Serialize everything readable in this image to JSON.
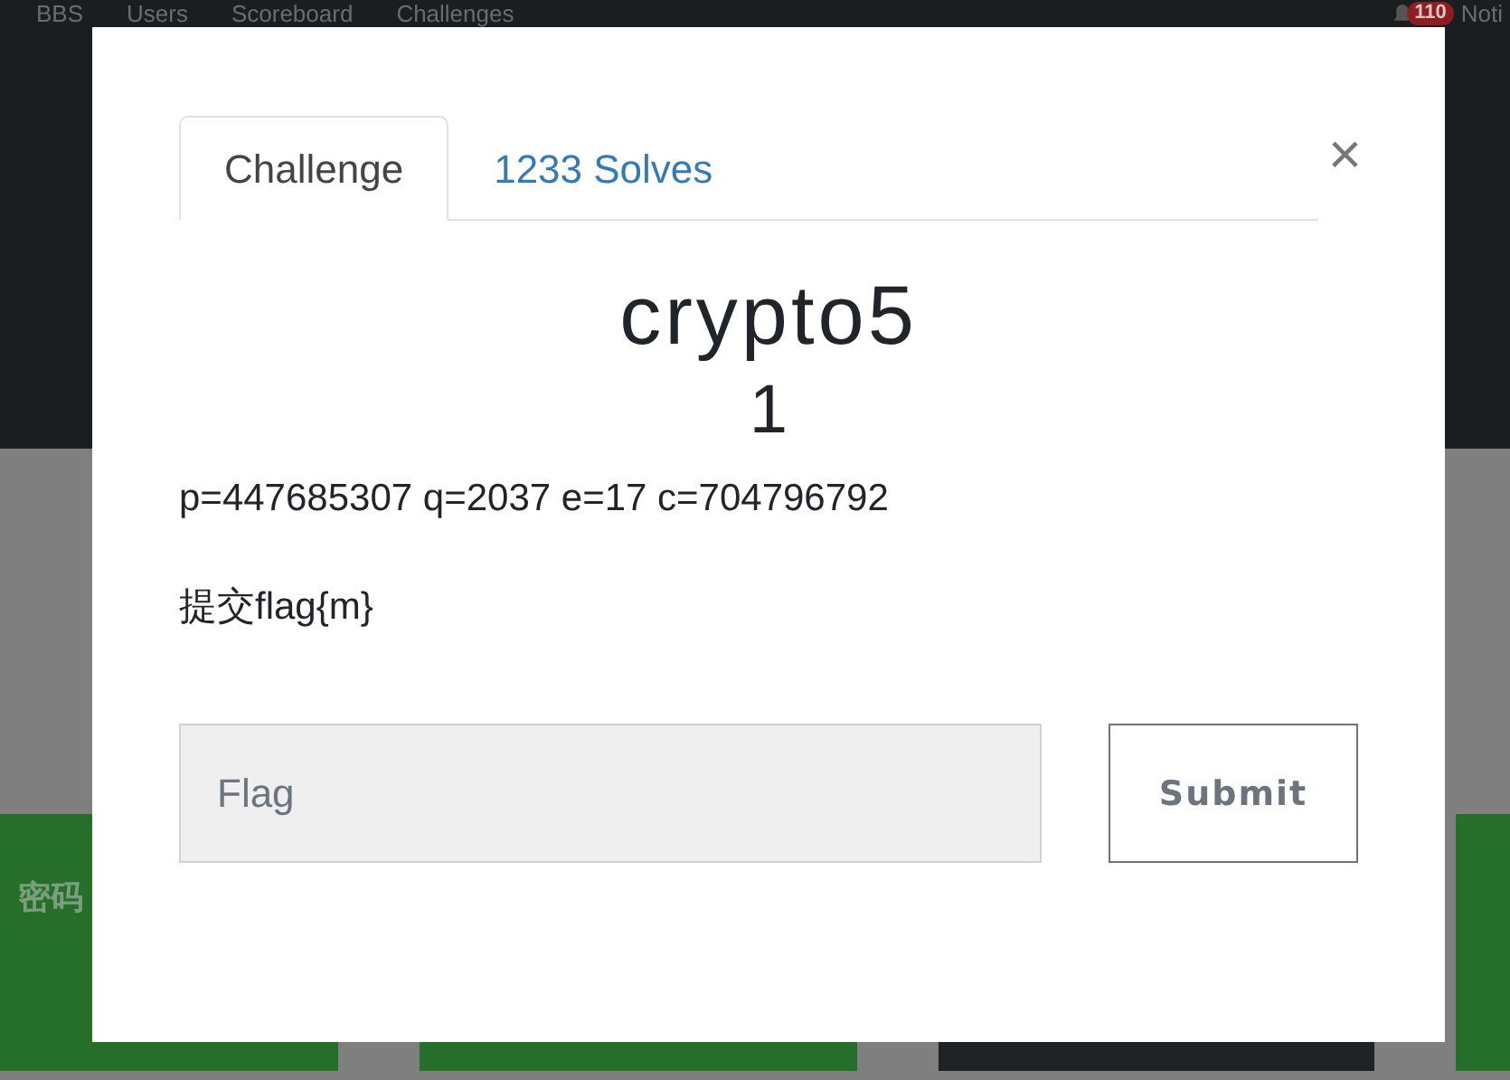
{
  "navbar": {
    "links": [
      "BBS",
      "Users",
      "Scoreboard",
      "Challenges"
    ],
    "notification_count": "110",
    "notifications_label": "Noti"
  },
  "cards": [
    {
      "kind": "green",
      "label": "密码"
    },
    {
      "kind": "green"
    },
    {
      "kind": "dark"
    },
    {
      "kind": "green"
    }
  ],
  "modal": {
    "tabs": [
      {
        "label": "Challenge",
        "selected": true
      },
      {
        "label": "1233 Solves",
        "selected": false
      }
    ],
    "close": "×",
    "title": "crypto5",
    "value": "1",
    "description": [
      "p=447685307 q=2037 e=17 c=704796792",
      "提交flag{m}"
    ],
    "flag_field": {
      "placeholder": "Flag"
    },
    "submit": "Submit"
  }
}
